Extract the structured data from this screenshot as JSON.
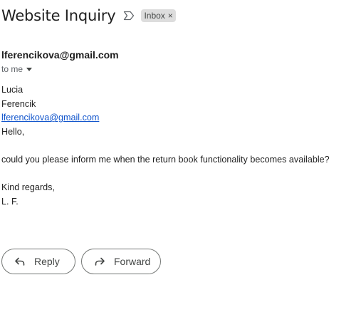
{
  "email": {
    "subject": "Website Inquiry",
    "label": "Inbox",
    "label_remove": "×",
    "sender": "lferencikova@gmail.com",
    "recipient": "to me",
    "body": {
      "first_name": "Lucia",
      "last_name": "Ferencik",
      "email_link": "lferencikova@gmail.com",
      "greeting": "Hello,",
      "blank1": "",
      "message": "could you please inform me when the return book functionality becomes available?",
      "blank2": "",
      "closing": "Kind regards,",
      "signature": "L. F."
    }
  },
  "actions": {
    "reply_label": "Reply",
    "forward_label": "Forward"
  },
  "icons": {
    "important": "label-important-icon",
    "caret": "caret-down-icon",
    "reply": "reply-icon",
    "forward": "forward-icon"
  },
  "colors": {
    "link": "#1155cc",
    "chip_bg": "#dddddd",
    "button_border": "#747775"
  }
}
